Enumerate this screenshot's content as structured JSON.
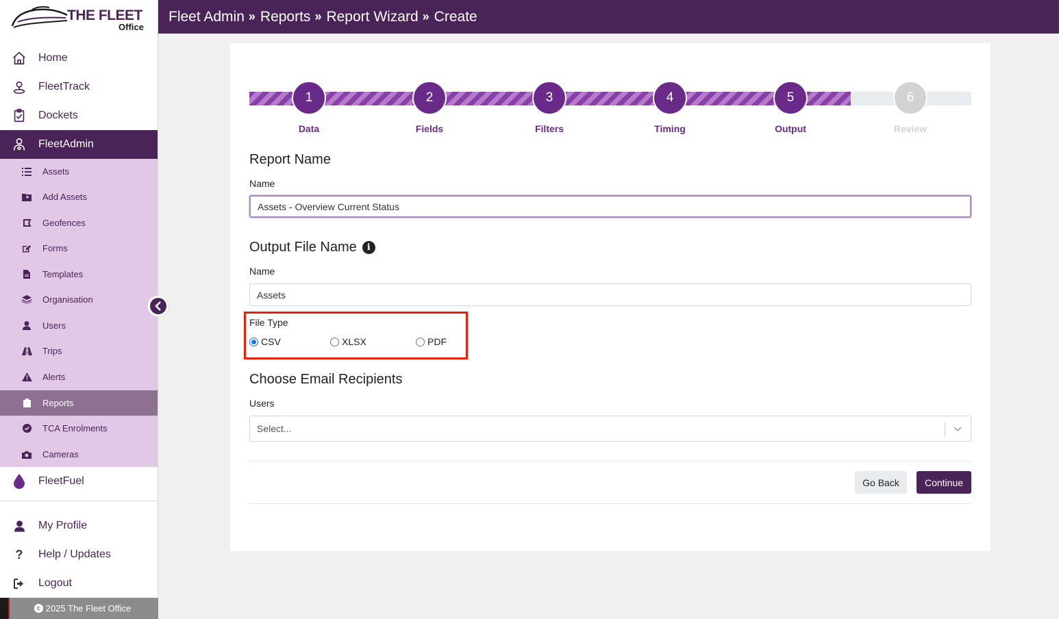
{
  "logo": {
    "title": "THE FLEET",
    "subtitle": "Office"
  },
  "header": {
    "crumbs": [
      "Fleet Admin",
      "Reports",
      "Report Wizard",
      "Create"
    ],
    "separator": "»"
  },
  "sidebar": {
    "main_top": [
      {
        "label": "Home",
        "icon": "home-icon"
      },
      {
        "label": "FleetTrack",
        "icon": "map-pin-icon"
      },
      {
        "label": "Dockets",
        "icon": "clipboard-check-icon"
      },
      {
        "label": "FleetAdmin",
        "icon": "user-cog-icon",
        "active": true
      }
    ],
    "sub": [
      {
        "label": "Assets",
        "icon": "list-icon"
      },
      {
        "label": "Add Assets",
        "icon": "folder-plus-icon"
      },
      {
        "label": "Geofences",
        "icon": "draw-polygon-icon"
      },
      {
        "label": "Forms",
        "icon": "edit-icon"
      },
      {
        "label": "Templates",
        "icon": "file-icon"
      },
      {
        "label": "Organisation",
        "icon": "layers-icon"
      },
      {
        "label": "Users",
        "icon": "user-icon"
      },
      {
        "label": "Trips",
        "icon": "road-icon"
      },
      {
        "label": "Alerts",
        "icon": "warning-icon"
      },
      {
        "label": "Reports",
        "icon": "clipboard-icon",
        "active": true
      },
      {
        "label": "TCA Enrolments",
        "icon": "check-circle-icon"
      },
      {
        "label": "Cameras",
        "icon": "camera-icon"
      }
    ],
    "fuel": {
      "label": "FleetFuel",
      "icon": "droplet-icon"
    },
    "bottom": [
      {
        "label": "My Profile",
        "icon": "user-icon"
      },
      {
        "label": "Help / Updates",
        "icon": "question-icon"
      },
      {
        "label": "Logout",
        "icon": "sign-out-icon"
      }
    ],
    "footer": "2025 The Fleet Office"
  },
  "wizard": {
    "steps": [
      {
        "num": "1",
        "label": "Data",
        "done": true
      },
      {
        "num": "2",
        "label": "Fields",
        "done": true
      },
      {
        "num": "3",
        "label": "Filters",
        "done": true
      },
      {
        "num": "4",
        "label": "Timing",
        "done": true
      },
      {
        "num": "5",
        "label": "Output",
        "done": true
      },
      {
        "num": "6",
        "label": "Review",
        "done": false
      }
    ],
    "progress": 0.833
  },
  "form": {
    "report_name_heading": "Report Name",
    "name_label": "Name",
    "report_name_value": "Assets - Overview Current Status",
    "output_heading": "Output File Name",
    "output_name_label": "Name",
    "output_name_value": "Assets",
    "file_type_label": "File Type",
    "file_types": [
      {
        "label": "CSV",
        "checked": true
      },
      {
        "label": "XLSX",
        "checked": false
      },
      {
        "label": "PDF",
        "checked": false
      }
    ],
    "email_heading": "Choose Email Recipients",
    "users_label": "Users",
    "users_placeholder": "Select...",
    "back_label": "Go Back",
    "continue_label": "Continue"
  },
  "colors": {
    "brand": "#4a2458",
    "accent": "#6a2a8a",
    "highlight": "#e8200e"
  }
}
